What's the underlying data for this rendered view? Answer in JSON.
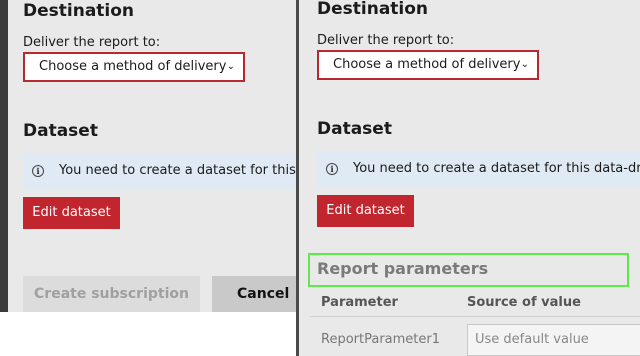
{
  "destination": {
    "heading": "Destination",
    "deliver_label": "Deliver the report to:",
    "delivery_select": "Choose a method of delivery",
    "chevron": "⌄"
  },
  "dataset": {
    "heading": "Dataset",
    "info_icon": "i",
    "info_text_left": "You need to create a dataset for this d",
    "info_text_right": "You need to create a dataset for this data-drive",
    "edit_button": "Edit dataset"
  },
  "footer": {
    "create_button": "Create subscription",
    "cancel_button": "Cancel"
  },
  "report_parameters": {
    "heading": "Report parameters",
    "columns": [
      "Parameter",
      "Source of value"
    ],
    "rows": [
      {
        "parameter": "ReportParameter1",
        "source": "Use default value"
      }
    ]
  },
  "colors": {
    "accent_red": "#c1252d",
    "select_border": "#b52a30",
    "highlight_green": "#5fe84a",
    "info_background": "#dfeaf5"
  },
  "icons": [
    "info-icon",
    "chevron-down-icon"
  ]
}
